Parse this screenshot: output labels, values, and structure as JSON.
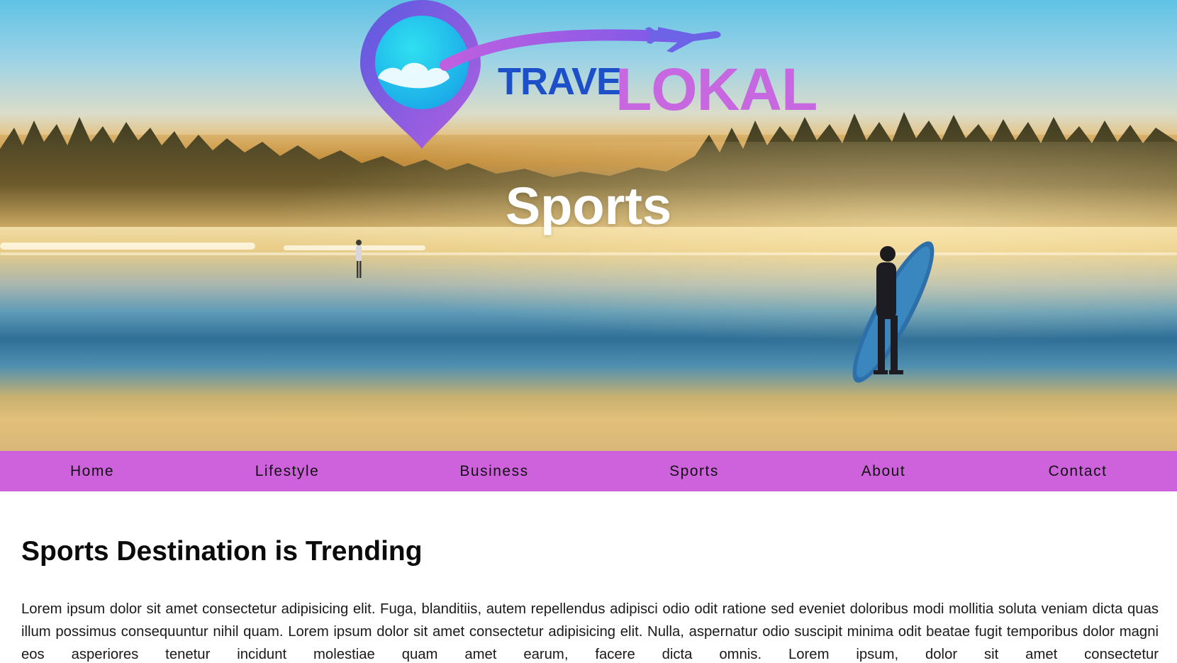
{
  "brand": {
    "logo_text_part1": "TRAVE",
    "logo_text_part2": "LOKAL",
    "colors": {
      "blue": "#1d4fc9",
      "pink": "#c768e0",
      "cyan": "#1ec9ea"
    }
  },
  "hero": {
    "title": "Sports",
    "image_icon": "beach-surfer-photo"
  },
  "nav": {
    "background": "#cd62dc",
    "items": [
      {
        "label": "Home"
      },
      {
        "label": "Lifestyle"
      },
      {
        "label": "Business"
      },
      {
        "label": "Sports"
      },
      {
        "label": "About"
      },
      {
        "label": "Contact"
      }
    ]
  },
  "main": {
    "heading": "Sports Destination is Trending",
    "paragraph": "Lorem ipsum dolor sit amet consectetur adipisicing elit. Fuga, blanditiis, autem repellendus adipisci odio odit ratione sed eveniet doloribus modi mollitia soluta veniam dicta quas illum possimus consequuntur nihil quam. Lorem ipsum dolor sit amet consectetur adipisicing elit. Nulla, aspernatur odio suscipit minima odit beatae fugit temporibus dolor magni eos asperiores tenetur incidunt molestiae quam amet earum, facere dicta omnis. Lorem ipsum, dolor sit amet consectetur"
  }
}
